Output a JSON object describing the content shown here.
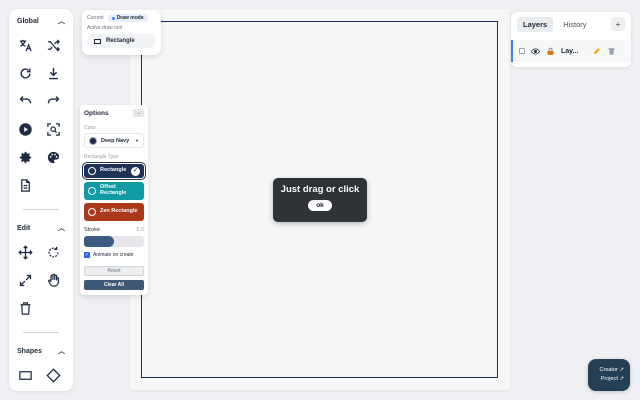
{
  "toolbar": {
    "global": {
      "title": "Global"
    },
    "edit": {
      "title": "Edit"
    },
    "shapes": {
      "title": "Shapes"
    }
  },
  "status": {
    "current_label": "Current",
    "mode": "Draw mode",
    "sub_label": "Active draw tool",
    "tool": "Rectangle"
  },
  "options": {
    "title": "Options",
    "color_label": "Color",
    "color_value": "Deep Navy",
    "color_hex": "#1b2a4a",
    "type_label": "Rectangle Type",
    "types": [
      {
        "label": "Rectangle",
        "color": "#1e3357",
        "selected": true
      },
      {
        "label": "Offset Rectangle",
        "color": "#0f9aa4",
        "selected": false
      },
      {
        "label": "Zen Rectangle",
        "color": "#a9381c",
        "selected": false
      }
    ],
    "stroke_label": "Stroke",
    "stroke_value": "5.0",
    "stroke_fraction": 0.5,
    "animate_label": "Animate on create",
    "animate_checked": true,
    "reset_label": "Reset",
    "clear_label": "Clear All"
  },
  "toast": {
    "message": "Just drag or click",
    "ok_label": "ok"
  },
  "panel": {
    "tabs": [
      {
        "label": "Layers",
        "active": true
      },
      {
        "label": "History",
        "active": false
      }
    ],
    "add_label": "+",
    "layer_name": "Lay..."
  },
  "creator": {
    "line1": "Creator ↗",
    "line2": "Project ↗"
  }
}
